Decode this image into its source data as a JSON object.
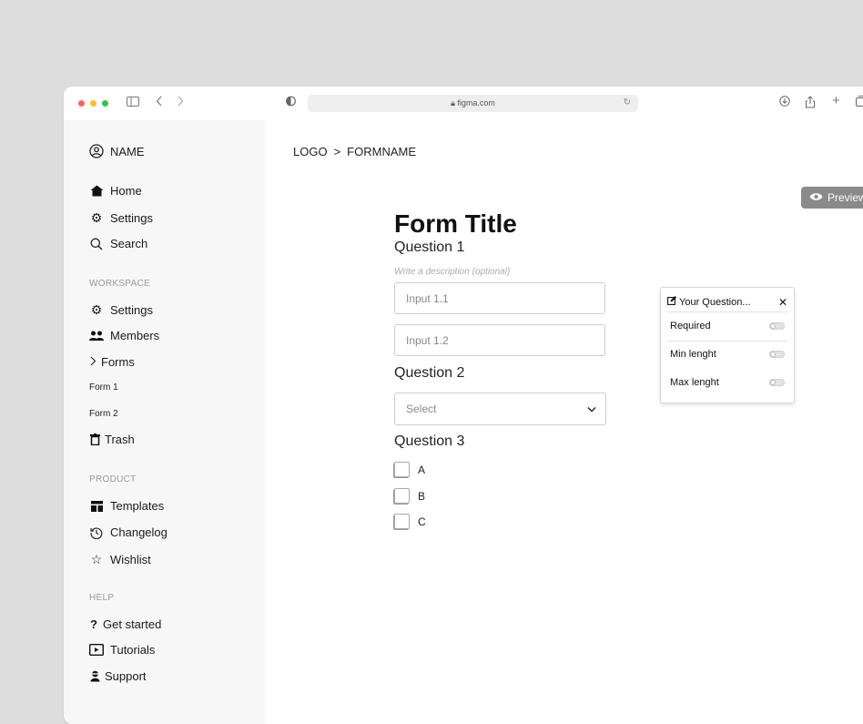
{
  "browser": {
    "url": "figma.com",
    "traffic_colors": [
      "#ff5f57",
      "#febc2e",
      "#28c840"
    ]
  },
  "sidebar": {
    "user": {
      "icon": "user-circle-icon",
      "label": "NAME"
    },
    "top_items": [
      {
        "icon": "home-icon",
        "label": "Home"
      },
      {
        "icon": "gear-icon",
        "label": "Settings"
      },
      {
        "icon": "search-icon",
        "label": "Search"
      }
    ],
    "workspace": {
      "label": "WORKSPACE",
      "items": [
        {
          "icon": "gear-icon",
          "label": "Settings"
        },
        {
          "icon": "members-icon",
          "label": "Members"
        },
        {
          "icon": "chevron-right-icon",
          "label": "Forms"
        },
        {
          "label": "Form 1"
        },
        {
          "label": "Form 2"
        },
        {
          "icon": "trash-icon",
          "label": "Trash"
        }
      ]
    },
    "product": {
      "label": "PRODUCT",
      "items": [
        {
          "icon": "templates-icon",
          "label": "Templates"
        },
        {
          "icon": "history-icon",
          "label": "Changelog"
        },
        {
          "icon": "star-icon",
          "label": "Wishlist"
        }
      ]
    },
    "help": {
      "label": "HELP",
      "items": [
        {
          "icon": "question-icon",
          "label": "Get started"
        },
        {
          "icon": "video-icon",
          "label": "Tutorials"
        },
        {
          "icon": "support-icon",
          "label": "Support"
        }
      ]
    }
  },
  "main": {
    "breadcrumb": {
      "root": "LOGO",
      "separator": ">",
      "current": "FORMNAME"
    },
    "preview_label": "Preview",
    "form": {
      "title": "Form Title",
      "questions": [
        {
          "label": "Question 1",
          "description": "Write a description (optional)",
          "inputs": [
            "Input 1.1",
            "Input 1.2"
          ]
        },
        {
          "label": "Question 2",
          "select_placeholder": "Select"
        },
        {
          "label": "Question 3",
          "options": [
            "A",
            "B",
            "C"
          ]
        }
      ]
    },
    "popover": {
      "title": "Your Question...",
      "rows": [
        {
          "label": "Required",
          "enabled": false
        },
        {
          "label": "Min lenght",
          "enabled": false
        },
        {
          "label": "Max lenght",
          "enabled": false
        }
      ]
    }
  }
}
